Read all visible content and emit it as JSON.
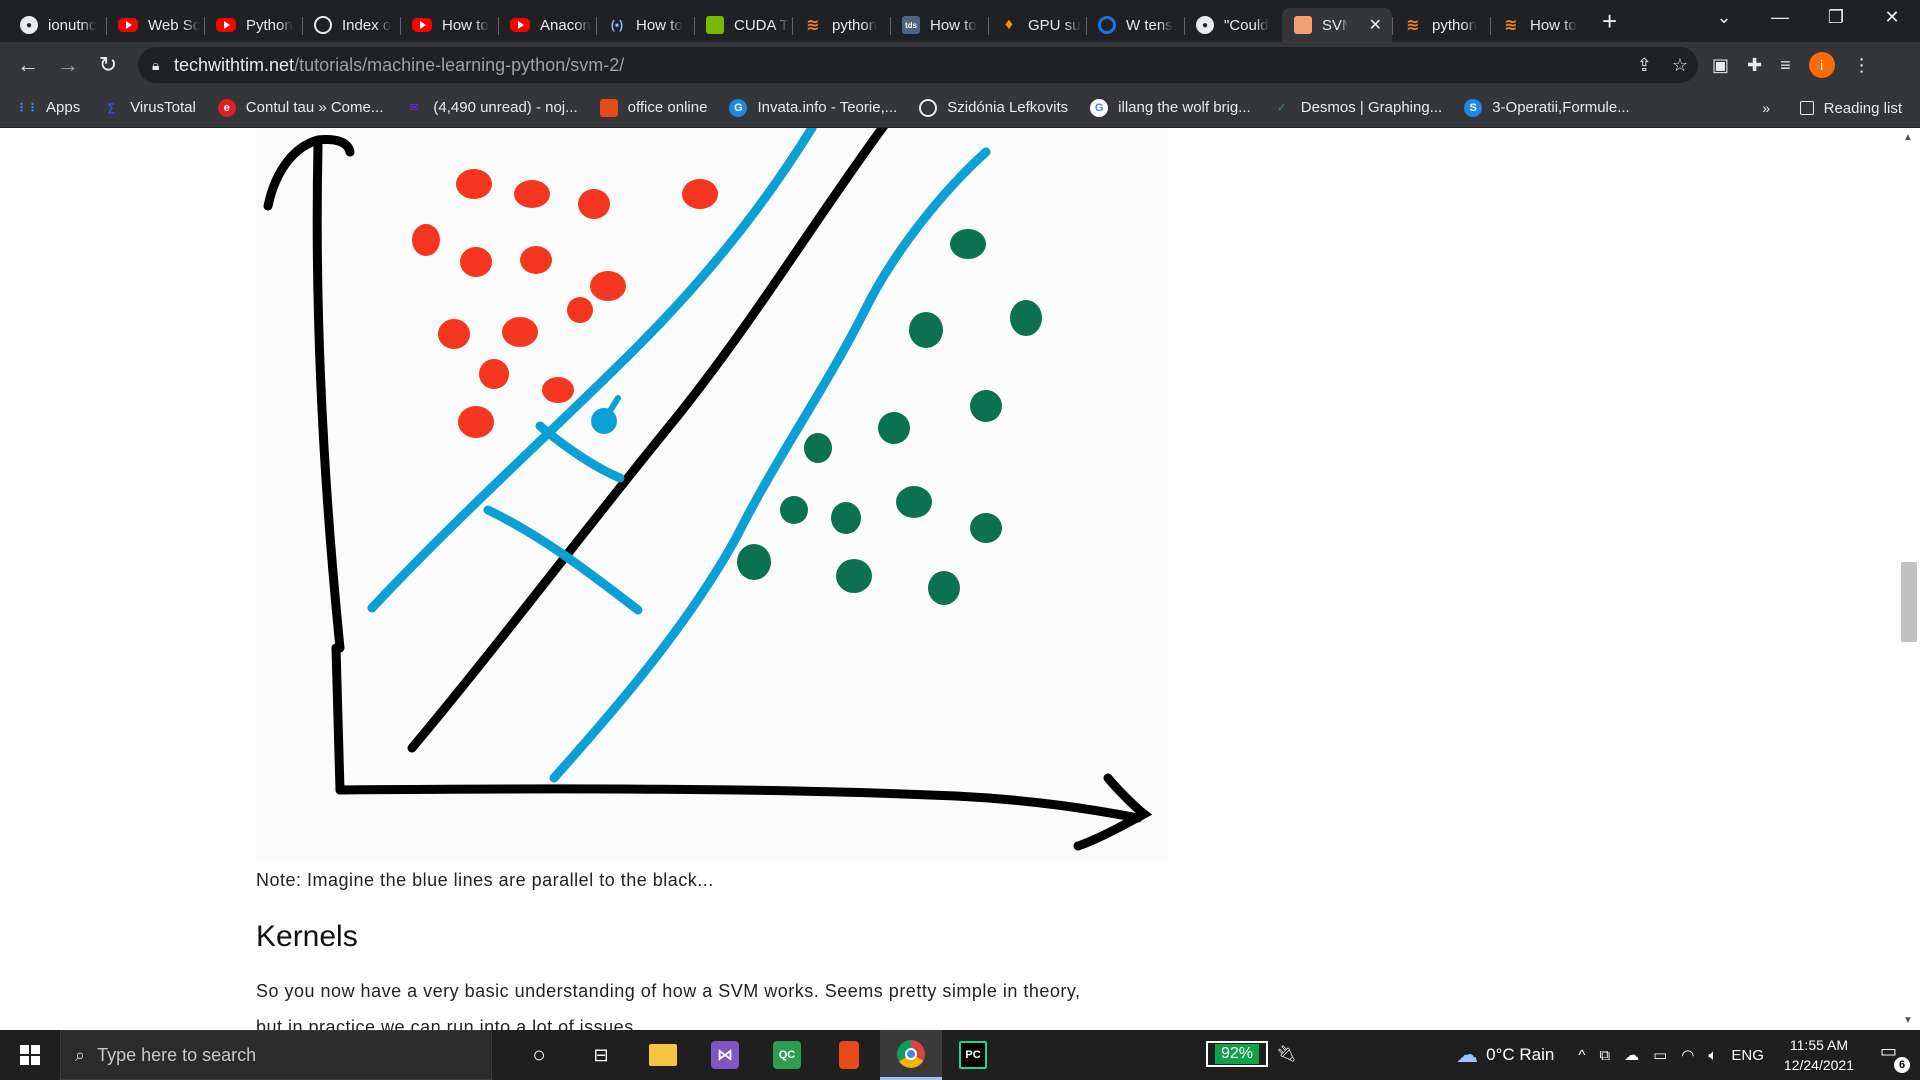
{
  "browser": {
    "tabs": [
      {
        "title": "ionutnc",
        "icon": "github-icon"
      },
      {
        "title": "Web Sc",
        "icon": "youtube-icon"
      },
      {
        "title": "Python",
        "icon": "youtube-icon"
      },
      {
        "title": "Index o",
        "icon": "globe-icon"
      },
      {
        "title": "How to",
        "icon": "youtube-icon"
      },
      {
        "title": "Anacon",
        "icon": "youtube-icon"
      },
      {
        "title": "How to",
        "icon": "podcast-icon"
      },
      {
        "title": "CUDA T",
        "icon": "nvidia-icon"
      },
      {
        "title": "python",
        "icon": "stackoverflow-icon"
      },
      {
        "title": "How to",
        "icon": "tds-icon"
      },
      {
        "title": "GPU su",
        "icon": "tensorflow-icon"
      },
      {
        "title": "W tens",
        "icon": "ring-icon"
      },
      {
        "title": "\"Could",
        "icon": "github-icon"
      },
      {
        "title": "SVM",
        "icon": "svm-icon",
        "active": true
      },
      {
        "title": "python",
        "icon": "stackoverflow-icon"
      },
      {
        "title": "How to",
        "icon": "stackoverflow-icon"
      }
    ],
    "tds_favicon_text": "tds",
    "address": {
      "host": "techwithtim.net",
      "path": "/tutorials/machine-learning-python/svm-2/"
    },
    "profile_initial": "i",
    "bookmarks": [
      {
        "label": "Apps",
        "icon": "apps-grid-icon"
      },
      {
        "label": "VirusTotal",
        "icon": "virustotal-icon"
      },
      {
        "label": "Contul tau » Come...",
        "icon": "emag-icon"
      },
      {
        "label": "(4,490 unread) - noj...",
        "icon": "yahoo-mail-icon"
      },
      {
        "label": "office online",
        "icon": "office-icon"
      },
      {
        "label": "Invata.info - Teorie,...",
        "icon": "invata-icon"
      },
      {
        "label": "Szidónia Lefkovits",
        "icon": "globe-icon"
      },
      {
        "label": "illang the wolf brig...",
        "icon": "google-icon"
      },
      {
        "label": "Desmos | Graphing...",
        "icon": "desmos-icon"
      },
      {
        "label": "3-Operatii,Formule...",
        "icon": "s-icon"
      }
    ],
    "bookmarks_overflow": "»",
    "reading_list": "Reading list"
  },
  "page": {
    "figure": {
      "red_points": 15,
      "green_points": 15,
      "colors": {
        "red": "#f4351f",
        "green": "#0c7150",
        "blue": "#0aa0d6",
        "black": "#000000"
      }
    },
    "note": "Note: Imagine the blue lines are parallel to the black...",
    "heading": "Kernels",
    "paragraph_1": "So you now have a very basic understanding of how a SVM works. Seems pretty simple in theory,",
    "paragraph_2": "but in practice we can run into a lot of issues."
  },
  "taskbar": {
    "search_placeholder": "Type here to search",
    "battery": "92%",
    "weather": "0°C  Rain",
    "language": "ENG",
    "time": "11:55 AM",
    "date": "12/24/2021",
    "notifications": "6",
    "pycharm_label": "PC",
    "qc_label": "QC"
  }
}
